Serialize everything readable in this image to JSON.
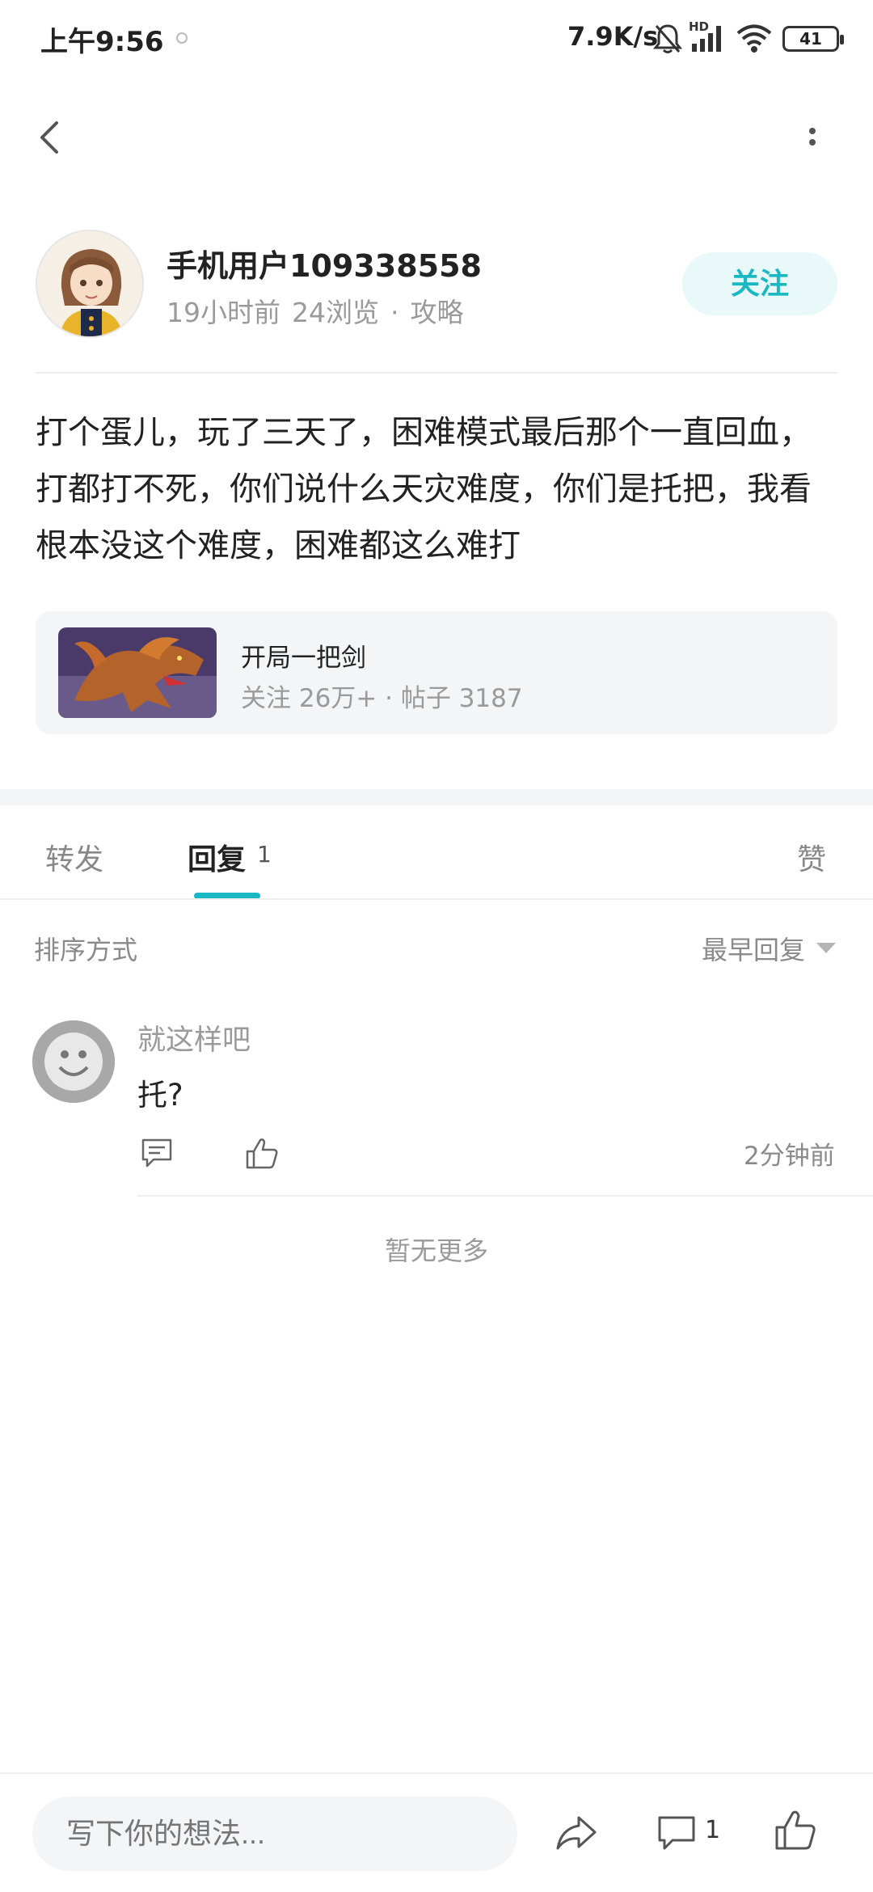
{
  "status_bar": {
    "time": "上午9:56",
    "network_speed": "7.9K/s",
    "hd_label": "HD",
    "battery": "41",
    "icons": [
      "silent-bell-icon",
      "signal-icon",
      "wifi-icon",
      "battery-icon"
    ]
  },
  "header": {
    "icons": [
      "back-arrow-icon",
      "more-vertical-icon"
    ]
  },
  "author": {
    "name": "手机用户109338558",
    "time_ago": "19小时前",
    "views": "24浏览",
    "separator": "·",
    "category": "攻略",
    "follow_label": "关注"
  },
  "post": {
    "body": "打个蛋儿，玩了三天了，困难模式最后那个一直回血，打都打不死，你们说什么天灾难度，你们是托把，我看根本没这个难度，困难都这么难打"
  },
  "forum": {
    "name": "开局一把剑",
    "stats": "关注 26万+ · 帖子 3187"
  },
  "tabs": {
    "forward": "转发",
    "reply": "回复",
    "reply_count": "1",
    "like": "赞",
    "accent": "#19b8c2"
  },
  "sort": {
    "label": "排序方式",
    "selected": "最早回复"
  },
  "comments": [
    {
      "user": "就这样吧",
      "text": "托?",
      "time": "2分钟前"
    }
  ],
  "no_more": "暂无更多",
  "bottom_bar": {
    "input_placeholder": "写下你的想法...",
    "comment_count": "1",
    "icons": [
      "share-icon",
      "comment-icon",
      "thumbs-up-icon"
    ]
  }
}
